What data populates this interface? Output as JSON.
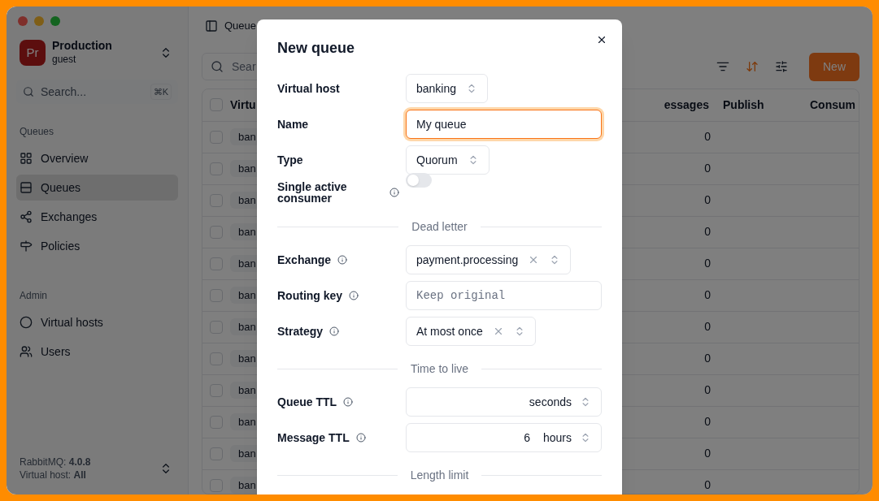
{
  "sidebar": {
    "workspace": {
      "avatar": "Pr",
      "name": "Production",
      "user": "guest"
    },
    "search": {
      "placeholder": "Search...",
      "shortcut": "⌘K"
    },
    "sections": [
      {
        "title": "Queues",
        "items": [
          {
            "label": "Overview",
            "selected": false
          },
          {
            "label": "Queues",
            "selected": true
          },
          {
            "label": "Exchanges",
            "selected": false
          },
          {
            "label": "Policies",
            "selected": false
          }
        ]
      },
      {
        "title": "Admin",
        "items": [
          {
            "label": "Virtual hosts",
            "selected": false
          },
          {
            "label": "Users",
            "selected": false
          }
        ]
      }
    ],
    "footer": [
      {
        "label": "RabbitMQ:",
        "value": "4.0.8"
      },
      {
        "label": "Virtual host:",
        "value": "All"
      }
    ]
  },
  "main": {
    "breadcrumb": "Queue",
    "search": {
      "placeholder": "Sear"
    },
    "sort_active": true,
    "new_button": "New",
    "table": {
      "columns": [
        "Virtu",
        "essages",
        "Publish",
        "Consum"
      ],
      "all_checked": false,
      "rows": [
        {
          "checked": false,
          "vhost": "ban",
          "messages": "0"
        },
        {
          "checked": false,
          "vhost": "ban",
          "messages": "0"
        },
        {
          "checked": false,
          "vhost": "ban",
          "messages": "0"
        },
        {
          "checked": false,
          "vhost": "ban",
          "messages": "0"
        },
        {
          "checked": false,
          "vhost": "ban",
          "messages": "0"
        },
        {
          "checked": false,
          "vhost": "ban",
          "messages": "0"
        },
        {
          "checked": false,
          "vhost": "ban",
          "messages": "0"
        },
        {
          "checked": false,
          "vhost": "ban",
          "messages": "0"
        },
        {
          "checked": false,
          "vhost": "ban",
          "messages": "0"
        },
        {
          "checked": false,
          "vhost": "ban",
          "messages": "0"
        },
        {
          "checked": false,
          "vhost": "ban",
          "messages": "0"
        },
        {
          "checked": false,
          "vhost": "ban",
          "messages": "0"
        }
      ]
    }
  },
  "dialog": {
    "title": "New queue",
    "fields": [
      {
        "kind": "select",
        "label": "Virtual host",
        "info": false,
        "value": "banking"
      },
      {
        "kind": "input",
        "label": "Name",
        "info": false,
        "value": "My queue",
        "focused": true
      },
      {
        "kind": "select",
        "label": "Type",
        "info": false,
        "value": "Quorum"
      },
      {
        "kind": "toggle",
        "label": "Single active consumer",
        "info": true,
        "on": false
      },
      {
        "kind": "divider",
        "label": "Dead letter"
      },
      {
        "kind": "combo",
        "label": "Exchange",
        "info": true,
        "value": "payment.processing"
      },
      {
        "kind": "input",
        "label": "Routing key",
        "info": true,
        "placeholder": "Keep original",
        "focused": false
      },
      {
        "kind": "combo",
        "label": "Strategy",
        "info": true,
        "value": "At most once"
      },
      {
        "kind": "divider",
        "label": "Time to live"
      },
      {
        "kind": "duration",
        "label": "Queue TTL",
        "info": true,
        "unit": "seconds"
      },
      {
        "kind": "duration",
        "label": "Message TTL",
        "info": true,
        "amount": "6",
        "unit": "hours"
      },
      {
        "kind": "divider",
        "label": "Length limit"
      }
    ]
  }
}
